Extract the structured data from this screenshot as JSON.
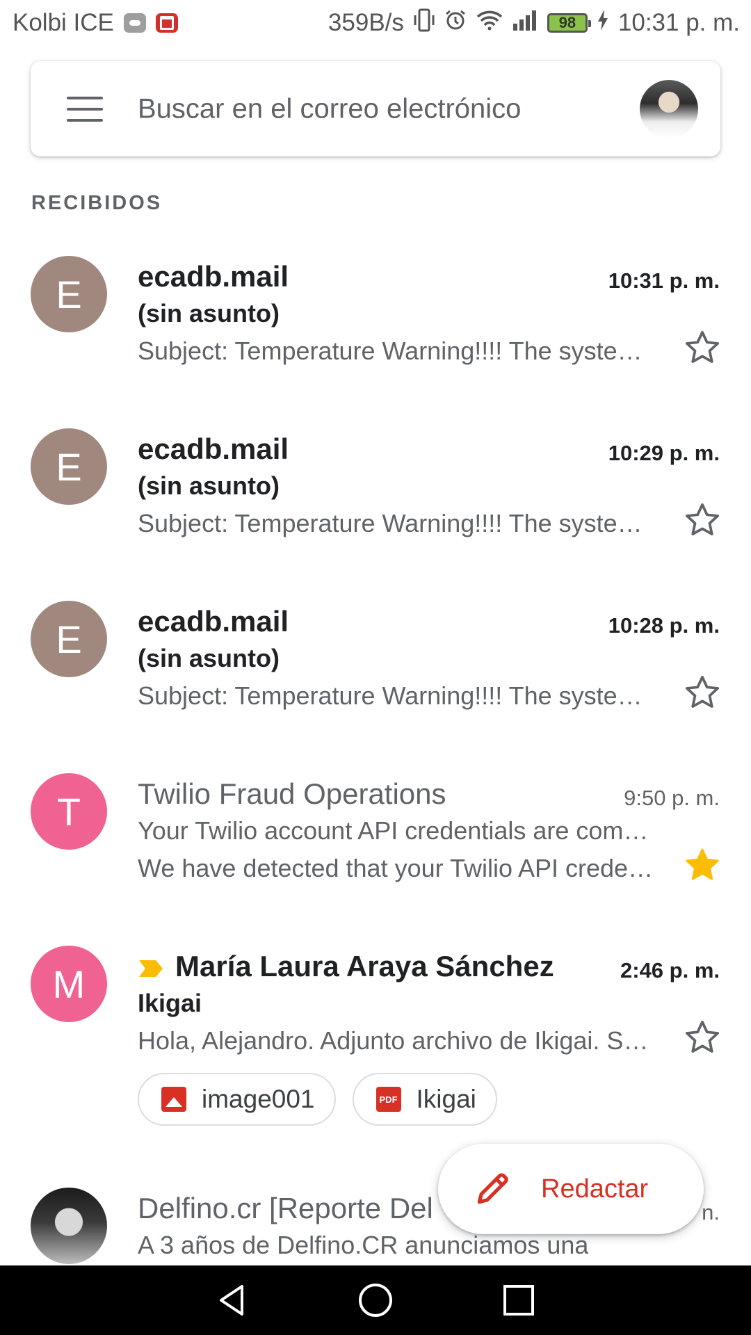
{
  "status_bar": {
    "carrier": "Kolbi ICE",
    "speed": "359B/s",
    "battery": "98",
    "time": "10:31 p. m.",
    "icons": [
      "message-icon",
      "mail-app-icon",
      "vibrate-icon",
      "alarm-icon",
      "wifi-icon",
      "signal-icon",
      "battery-icon",
      "charging-icon"
    ]
  },
  "search": {
    "placeholder": "Buscar en el correo electrónico"
  },
  "section_label": "RECIBIDOS",
  "emails": [
    {
      "avatar_letter": "E",
      "avatar_color": "#a1887f",
      "sender": "ecadb.mail",
      "time": "10:31 p. m.",
      "subject": "(sin asunto)",
      "snippet": "Subject: Temperature Warning!!!! The system is operating at elevated temperature",
      "unread": true,
      "starred": false
    },
    {
      "avatar_letter": "E",
      "avatar_color": "#a1887f",
      "sender": "ecadb.mail",
      "time": "10:29 p. m.",
      "subject": "(sin asunto)",
      "snippet": "Subject: Temperature Warning!!!! The system is operating at elevated temperature",
      "unread": true,
      "starred": false
    },
    {
      "avatar_letter": "E",
      "avatar_color": "#a1887f",
      "sender": "ecadb.mail",
      "time": "10:28 p. m.",
      "subject": "(sin asunto)",
      "snippet": "Subject: Temperature Warning!!!! The system is operating at elevated temperature",
      "unread": true,
      "starred": false
    },
    {
      "avatar_letter": "T",
      "avatar_color": "#f06292",
      "sender": "Twilio Fraud Operations",
      "time": "9:50 p. m.",
      "subject": "Your Twilio account API credentials are compromised",
      "snippet": "We have detected that your Twilio API credentials",
      "unread": false,
      "starred": true
    },
    {
      "avatar_letter": "M",
      "avatar_color": "#f06292",
      "sender": "María Laura Araya Sánchez",
      "time": "2:46 p. m.",
      "subject": "Ikigai",
      "snippet": "Hola, Alejandro. Adjunto archivo de Ikigai. Saludos",
      "unread": true,
      "starred": false,
      "important": true,
      "attachments": [
        {
          "name": "image001",
          "icon": "image-icon"
        },
        {
          "name": "Ikigai",
          "icon": "pdf-icon",
          "badge": "PDF"
        }
      ]
    },
    {
      "sender": "Delfino.cr [Reporte Del",
      "time": "n.",
      "snippet": "A 3 años de Delfino.CR anunciamos una",
      "unread": false,
      "starred": false
    }
  ],
  "compose": {
    "label": "Redactar",
    "color": "#d93025"
  },
  "star_color": "#fbbc04",
  "nav_bar": {
    "icons": [
      "back-icon",
      "home-icon",
      "recents-icon"
    ]
  }
}
